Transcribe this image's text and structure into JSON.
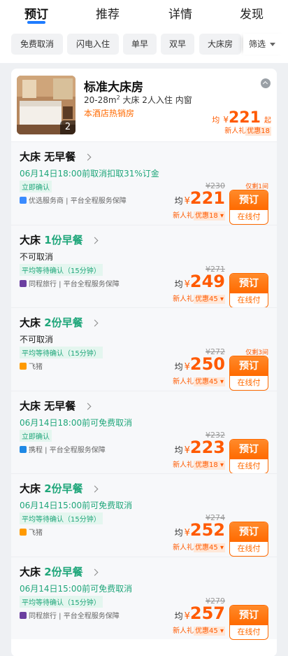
{
  "tabs": [
    "预订",
    "推荐",
    "详情",
    "发现"
  ],
  "active_tab": 0,
  "colors": {
    "accent": "#1f7cff",
    "price": "#ff5a00",
    "green": "#1fa67a"
  },
  "filters": [
    "免费取消",
    "闪电入住",
    "单早",
    "双早",
    "大床房"
  ],
  "filter_more": "筛选",
  "room": {
    "title": "标准大床房",
    "area": "20-28m",
    "area_sup": "2",
    "meta": "大床  2人入住  内窗",
    "tag": "本酒店热销房",
    "image_count": "2",
    "price_prefix": "均",
    "currency": "¥",
    "price": "221",
    "price_suffix": "起",
    "promo_label": "新人礼",
    "promo_value": "优惠18"
  },
  "plans": [
    {
      "bed": "大床",
      "breakfast": "无早餐",
      "breakfast_green": false,
      "cancel": "06月14日18:00前取消扣取31%订金",
      "cancel_green": true,
      "confirm": "立即确认",
      "provider": "优选服务商 | 平台全程服务保障",
      "provider_icon": "service-icon",
      "orig": "¥230",
      "price": "221",
      "promo_label": "新人礼",
      "promo_value": "优惠18 ▾",
      "remaining": "仅剩1间",
      "book": "预订",
      "pay": "在线付"
    },
    {
      "bed": "大床",
      "breakfast": "1份早餐",
      "breakfast_green": true,
      "cancel": "不可取消",
      "cancel_green": false,
      "confirm": "平均等待确认（15分钟）",
      "provider": "同程旅行 | 平台全程服务保障",
      "provider_icon": "tongcheng-icon",
      "orig": "¥271",
      "price": "249",
      "promo_label": "新人礼",
      "promo_value": "优惠45 ▾",
      "remaining": "",
      "book": "预订",
      "pay": "在线付"
    },
    {
      "bed": "大床",
      "breakfast": "2份早餐",
      "breakfast_green": true,
      "cancel": "不可取消",
      "cancel_green": false,
      "confirm": "平均等待确认（15分钟）",
      "provider": "飞猪",
      "provider_icon": "fliggy-icon",
      "orig": "¥272",
      "price": "250",
      "promo_label": "新人礼",
      "promo_value": "优惠45 ▾",
      "remaining": "仅剩3间",
      "book": "预订",
      "pay": "在线付"
    },
    {
      "bed": "大床",
      "breakfast": "无早餐",
      "breakfast_green": false,
      "cancel": "06月14日18:00前可免费取消",
      "cancel_green": true,
      "confirm": "立即确认",
      "provider": "携程 | 平台全程服务保障",
      "provider_icon": "ctrip-icon",
      "orig": "¥232",
      "price": "223",
      "promo_label": "新人礼",
      "promo_value": "优惠18 ▾",
      "remaining": "",
      "book": "预订",
      "pay": "在线付"
    },
    {
      "bed": "大床",
      "breakfast": "2份早餐",
      "breakfast_green": true,
      "cancel": "06月14日15:00前可免费取消",
      "cancel_green": true,
      "confirm": "平均等待确认（15分钟）",
      "provider": "飞猪",
      "provider_icon": "fliggy-icon",
      "orig": "¥274",
      "price": "252",
      "promo_label": "新人礼",
      "promo_value": "优惠45 ▾",
      "remaining": "",
      "book": "预订",
      "pay": "在线付"
    },
    {
      "bed": "大床",
      "breakfast": "2份早餐",
      "breakfast_green": true,
      "cancel": "06月14日15:00前可免费取消",
      "cancel_green": true,
      "confirm": "平均等待确认（15分钟）",
      "provider": "同程旅行 | 平台全程服务保障",
      "provider_icon": "tongcheng-icon",
      "orig": "¥279",
      "price": "257",
      "promo_label": "新人礼",
      "promo_value": "优惠45 ▾",
      "remaining": "",
      "book": "预订",
      "pay": "在线付"
    }
  ]
}
